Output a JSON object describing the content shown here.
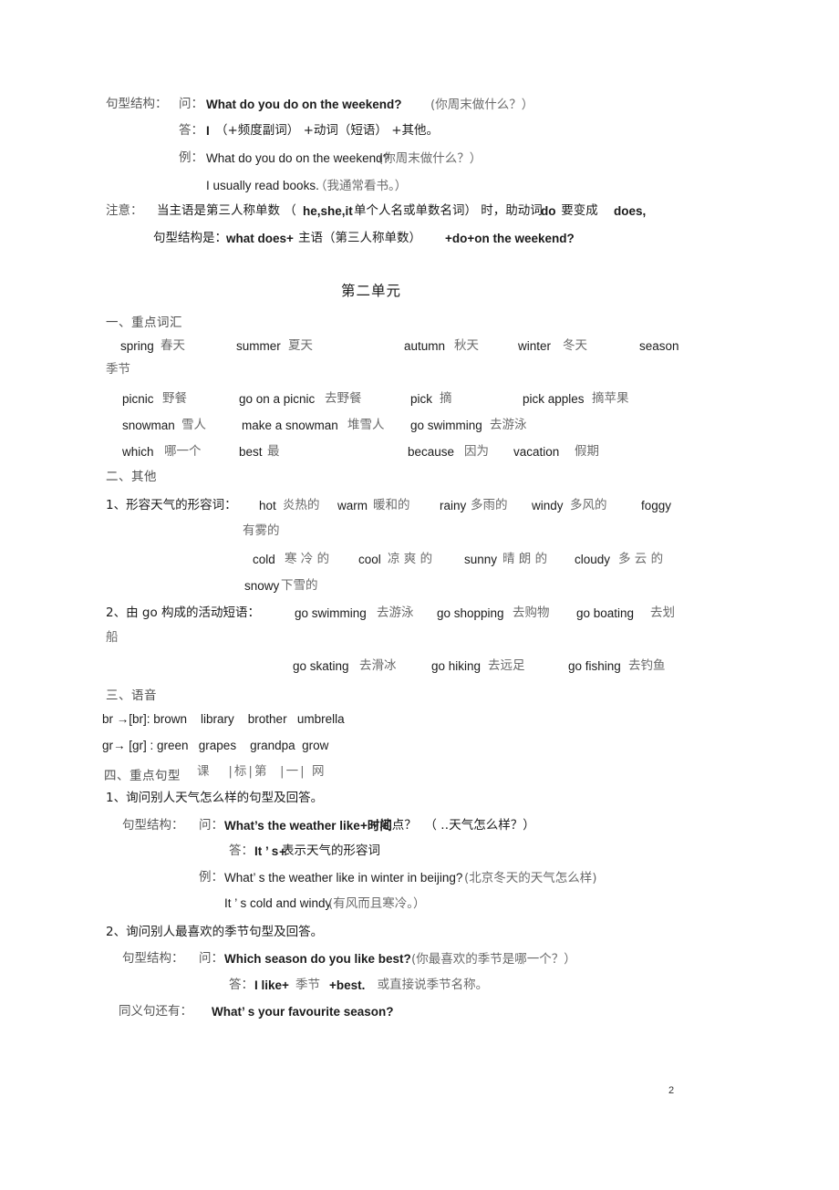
{
  "document": {
    "page_number": "2",
    "unit_title": "第二单元"
  },
  "unit_one_tail": {
    "line1_label": "句型结构：",
    "line1_q_label": "问：",
    "line1_en": "What do you do on the weekend?",
    "line1_cn": "(你周末做什么？）",
    "line2_a_label": "答：",
    "line2_i": "I",
    "line2_rest": "（+频度副词） +动词（短语） +其他。",
    "line3_label": "例：",
    "line3_en": "What do you do on the weekend?",
    "line3_cn": "(你周末做什么？）",
    "line4_en": "I usually read books.",
    "line4_cn": "（我通常看书。）",
    "note_label": "注意：",
    "note_part1": "当主语是第三人称单数 （",
    "note_pronouns": "he,she,it",
    "note_part2": "单个人名或单数名词） 时，助动词 ",
    "note_do": "do",
    "note_part3": " 要变成 ",
    "note_does": "does,",
    "note_line2_label": "句型结构是： ",
    "note_line2_a": "what does+",
    "note_line2_b": "主语（第三人称单数）",
    "note_line2_c": "+do+on the weekend?"
  },
  "sections": {
    "vocab_heading": "一、重点词汇",
    "other_heading": "二、其他",
    "phonics_heading": "三、语音",
    "patterns_heading": "四、重点句型",
    "watermark": "课   |标|第  |一| 网"
  },
  "vocab": {
    "row1": [
      {
        "en": "spring",
        "cn": "春天"
      },
      {
        "en": "summer",
        "cn": "夏天"
      },
      {
        "en": "autumn",
        "cn": "秋天"
      },
      {
        "en": "winter",
        "cn": "冬天"
      },
      {
        "en": "season",
        "cn": "季节"
      }
    ],
    "row1_wrap_cn": "季节",
    "row2": [
      {
        "en": "picnic",
        "cn": "野餐"
      },
      {
        "en": "go on a picnic",
        "cn": "去野餐"
      },
      {
        "en": "pick",
        "cn": "摘"
      },
      {
        "en": "pick apples",
        "cn": "摘苹果"
      }
    ],
    "row3": [
      {
        "en": "snowman",
        "cn": "雪人"
      },
      {
        "en": "make a snowman",
        "cn": "堆雪人"
      },
      {
        "en": "go swimming",
        "cn": "去游泳"
      }
    ],
    "row4": [
      {
        "en": "which",
        "cn": "哪一个"
      },
      {
        "en": "best",
        "cn": "最"
      },
      {
        "en": "because",
        "cn": "因为"
      },
      {
        "en": "vacation",
        "cn": "假期"
      }
    ]
  },
  "other": {
    "item1_label": "1、形容天气的形容词：",
    "weather_row1": [
      {
        "en": "hot",
        "cn": "炎热的"
      },
      {
        "en": "warm",
        "cn": "暖和的"
      },
      {
        "en": "rainy",
        "cn": "多雨的"
      },
      {
        "en": "windy",
        "cn": "多风的"
      },
      {
        "en": "foggy",
        "cn": ""
      }
    ],
    "weather_wrap_cn": "有雾的",
    "weather_row2": [
      {
        "en": "cold",
        "cn": "寒 冷 的"
      },
      {
        "en": "cool",
        "cn": "凉 爽 的"
      },
      {
        "en": "sunny",
        "cn": "晴 朗 的"
      },
      {
        "en": "cloudy",
        "cn": "多 云 的"
      }
    ],
    "weather_row3": [
      {
        "en": "snowy",
        "cn": "下雪的"
      }
    ],
    "item2_label": "2、由 go 构成的活动短语：",
    "go_row1": [
      {
        "en": "go swimming",
        "cn": "去游泳"
      },
      {
        "en": "go shopping",
        "cn": "去购物"
      },
      {
        "en": "go boating",
        "cn": "去划"
      }
    ],
    "go_wrap_cn": "船",
    "go_row2": [
      {
        "en": "go skating",
        "cn": "去滑冰"
      },
      {
        "en": "go hiking",
        "cn": "去远足"
      },
      {
        "en": "go fishing",
        "cn": "去钓鱼"
      }
    ]
  },
  "phonics": {
    "line1": "br →[br]: brown    library    brother   umbrella",
    "line2": "gr→ [gr] : green   grapes    grandpa  grow"
  },
  "patterns": {
    "p1_heading": "1、询问别人天气怎么样的句型及回答。",
    "p1_struct_label": "句型结构：",
    "p1_q_label": "问：",
    "p1_q_en": "What’s the weather like",
    "p1_q_overlay": "+时间",
    "p1_q_cn": "+地点？  （ ‥天气怎么样？）",
    "p1_a_label": "答：",
    "p1_a_en": "It ’ s",
    "p1_a_overlay": "+",
    "p1_a_cn": "表示天气的形容词",
    "p1_ex_label": "例：",
    "p1_ex_en": "What’ s the weather like in winter in beijing?",
    "p1_ex_cn": "(北京冬天的天气怎么样)",
    "p1_ex2_en": "It ’ s cold and windy",
    "p1_ex2_cn": "(有风而且寒冷。）",
    "p2_heading": "2、询问别人最喜欢的季节句型及回答。",
    "p2_struct_label": "句型结构：",
    "p2_q_label": "问：",
    "p2_q_en": "Which season do you like best?",
    "p2_q_cn": "(你最喜欢的季节是哪一个？）",
    "p2_a_label": "答：",
    "p2_a_en1": "I like+",
    "p2_a_cn1": "季节",
    "p2_a_en2": "+best.",
    "p2_a_cn2": "  或直接说季节名称。",
    "p2_syn_label": "同义句还有：",
    "p2_syn_en": "What’ s your favourite season?"
  }
}
